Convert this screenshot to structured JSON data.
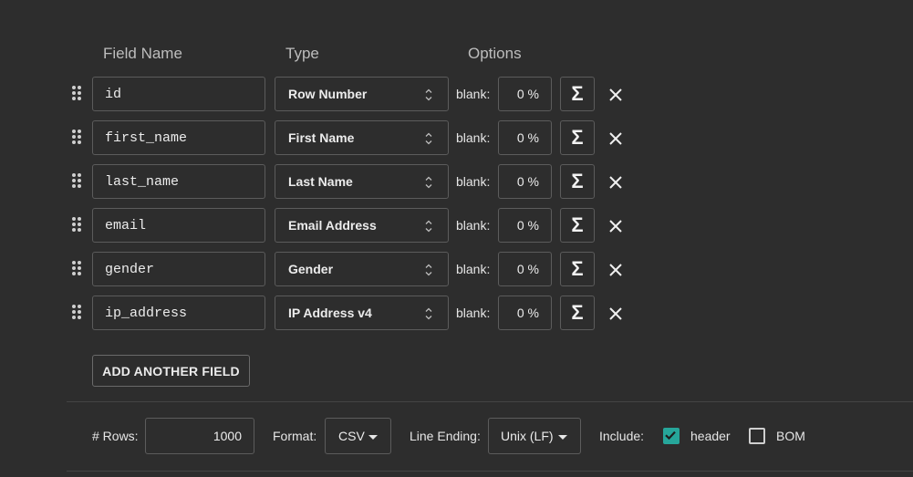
{
  "headers": {
    "field_name": "Field Name",
    "type": "Type",
    "options": "Options"
  },
  "fields": [
    {
      "name": "id",
      "type": "Row Number",
      "blank_label": "blank:",
      "blank_pct": "0 %",
      "sigma": "Σ"
    },
    {
      "name": "first_name",
      "type": "First Name",
      "blank_label": "blank:",
      "blank_pct": "0 %",
      "sigma": "Σ"
    },
    {
      "name": "last_name",
      "type": "Last Name",
      "blank_label": "blank:",
      "blank_pct": "0 %",
      "sigma": "Σ"
    },
    {
      "name": "email",
      "type": "Email Address",
      "blank_label": "blank:",
      "blank_pct": "0 %",
      "sigma": "Σ"
    },
    {
      "name": "gender",
      "type": "Gender",
      "blank_label": "blank:",
      "blank_pct": "0 %",
      "sigma": "Σ"
    },
    {
      "name": "ip_address",
      "type": "IP Address v4",
      "blank_label": "blank:",
      "blank_pct": "0 %",
      "sigma": "Σ"
    }
  ],
  "add_field_label": "ADD ANOTHER FIELD",
  "footer": {
    "rows_label": "# Rows:",
    "rows_value": "1000",
    "format_label": "Format:",
    "format_value": "CSV",
    "line_ending_label": "Line Ending:",
    "line_ending_value": "Unix (LF)",
    "include_label": "Include:",
    "header_label": "header",
    "header_checked": true,
    "bom_label": "BOM",
    "bom_checked": false
  },
  "colors": {
    "background": "#2d2d2d",
    "border": "#5c5c5c",
    "checkbox_checked": "#26a69a"
  }
}
